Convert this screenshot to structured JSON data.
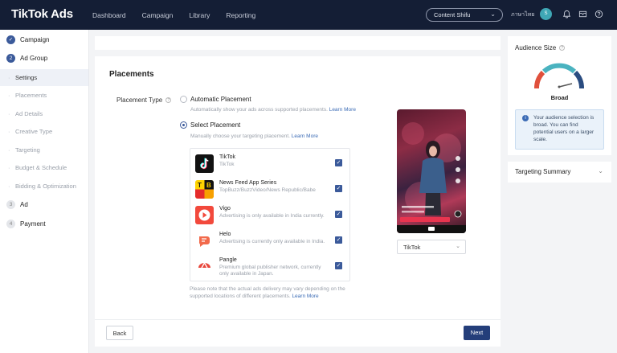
{
  "brand": {
    "logo": "TikTok Ads"
  },
  "topnav": {
    "items": [
      "Dashboard",
      "Campaign",
      "Library",
      "Reporting"
    ],
    "account": "Content Shifu",
    "language": "ภาษาไทย",
    "avatar": "S"
  },
  "sidebar": {
    "steps": [
      {
        "num": "",
        "label": "Campaign",
        "state": "done"
      },
      {
        "num": "2",
        "label": "Ad Group",
        "state": "current"
      }
    ],
    "subitems": [
      "Settings",
      "Placements",
      "Ad Details",
      "Creative Type",
      "Targeting",
      "Budget & Schedule",
      "Bidding & Optimization"
    ],
    "active_sub": "Settings",
    "later_steps": [
      {
        "num": "3",
        "label": "Ad"
      },
      {
        "num": "4",
        "label": "Payment"
      }
    ]
  },
  "main": {
    "title": "Placements",
    "placement_type_label": "Placement Type",
    "auto": {
      "label": "Automatic Placement",
      "desc": "Automatically show your ads across supported placements.",
      "link": "Learn More",
      "selected": false
    },
    "select": {
      "label": "Select Placement",
      "desc": "Manually choose your targeting placement.",
      "link": "Learn More",
      "selected": true
    },
    "placements": [
      {
        "name": "TikTok",
        "desc": "TikTok",
        "checked": true
      },
      {
        "name": "News Feed App Series",
        "desc": "TopBuzz/BuzzVideo/News Republic/Babe",
        "checked": true
      },
      {
        "name": "Vigo",
        "desc": "Advertising is only available in India currently.",
        "checked": true
      },
      {
        "name": "Helo",
        "desc": "Advertising is currently only available in India.",
        "checked": true
      },
      {
        "name": "Pangle",
        "desc": "Premium global publisher network, currently only available in Japan.",
        "checked": true
      }
    ],
    "note": "Please note that the actual ads delivery may vary depending on the supported locations of different placements.",
    "note_link": "Learn More",
    "preview_select": "TikTok",
    "back_label": "Back",
    "next_label": "Next"
  },
  "audience": {
    "title": "Audience Size",
    "level": "Broad",
    "info": "Your audience selection is broad. You can find potential users on a larger scale."
  },
  "targeting_summary": {
    "label": "Targeting Summary"
  },
  "colors": {
    "topbar": "#141e35",
    "accent": "#3b5a9a",
    "next_button": "#243e7a",
    "gauge_red": "#e0503c",
    "gauge_teal": "#4ab3c0",
    "gauge_blue": "#2a4c80"
  }
}
